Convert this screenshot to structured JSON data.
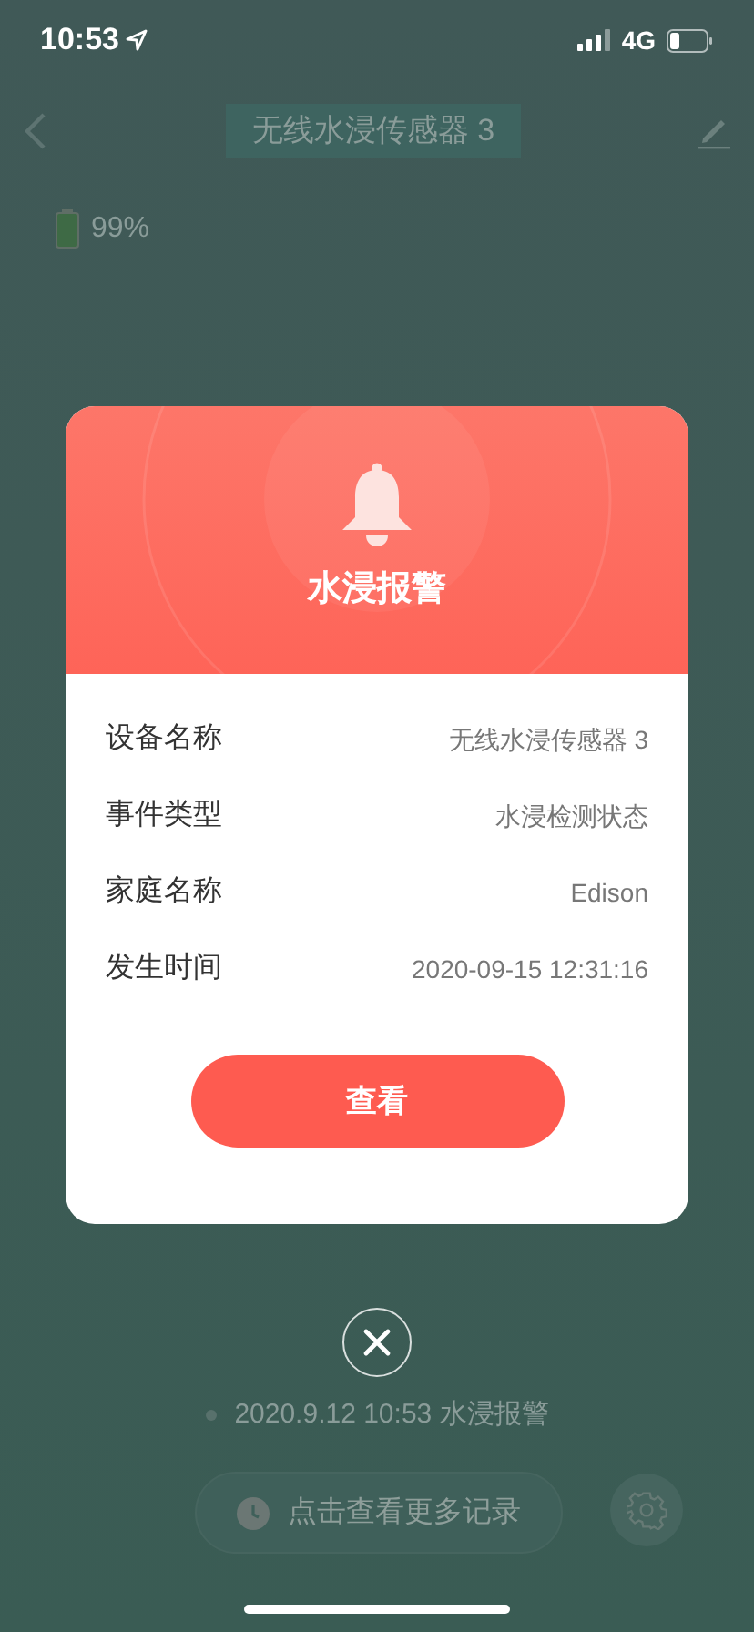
{
  "status_bar": {
    "time": "10:53",
    "network": "4G"
  },
  "nav": {
    "title": "无线水浸传感器 3"
  },
  "battery": {
    "reading": "99%"
  },
  "alert": {
    "title": "水浸报警",
    "rows": [
      {
        "label": "设备名称",
        "value": "无线水浸传感器 3"
      },
      {
        "label": "事件类型",
        "value": "水浸检测状态"
      },
      {
        "label": "家庭名称",
        "value": "Edison"
      },
      {
        "label": "发生时间",
        "value": "2020-09-15 12:31:16"
      }
    ],
    "button": "查看"
  },
  "history": {
    "entry": "2020.9.12 10:53 水浸报警",
    "more_button": "点击查看更多记录"
  }
}
